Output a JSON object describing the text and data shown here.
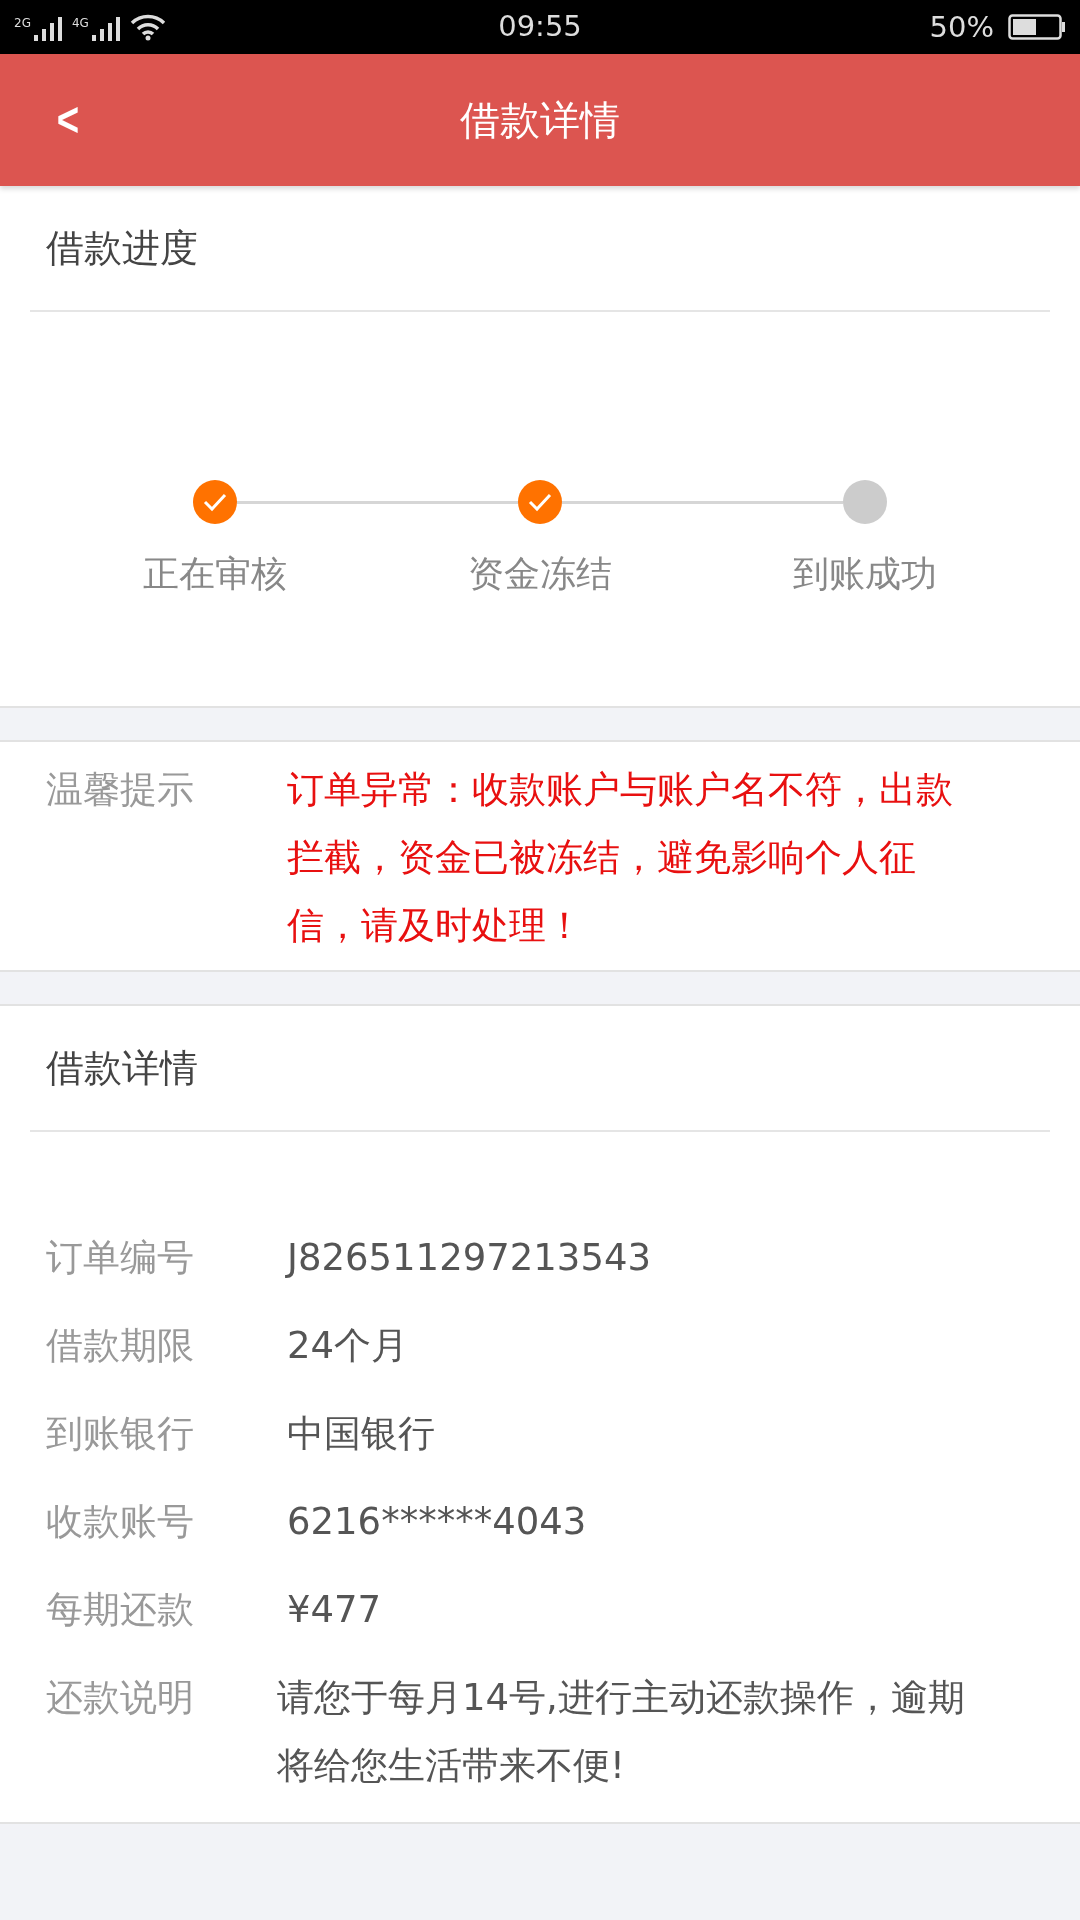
{
  "status_bar": {
    "network_1": "2G",
    "network_2": "4G",
    "time": "09:55",
    "battery": "50%"
  },
  "header": {
    "back": "<",
    "title": "借款详情"
  },
  "progress": {
    "title": "借款进度",
    "steps": [
      {
        "label": "正在审核",
        "done": true
      },
      {
        "label": "资金冻结",
        "done": true
      },
      {
        "label": "到账成功",
        "done": false
      }
    ]
  },
  "notice": {
    "label": "温馨提示",
    "text": "订单异常：收款账户与账户名不符，出款拦截，资金已被冻结，避免影响个人征信，请及时处理！"
  },
  "details": {
    "title": "借款详情",
    "rows": [
      {
        "label": "订单编号",
        "value": "J826511297213543"
      },
      {
        "label": "借款期限",
        "value": "24个月"
      },
      {
        "label": "到账银行",
        "value": "中国银行"
      },
      {
        "label": "收款账号",
        "value": "6216******4043"
      },
      {
        "label": "每期还款",
        "value": "¥477"
      },
      {
        "label": "还款说明",
        "value": "请您于每月14号,进行主动还款操作，逾期将给您生活带来不便!"
      }
    ]
  }
}
